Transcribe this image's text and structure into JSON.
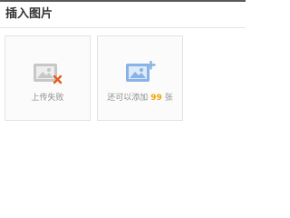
{
  "dialog": {
    "title": "插入图片"
  },
  "cards": {
    "failed": {
      "label": "上传失败",
      "icon": "image-failed-icon"
    },
    "add": {
      "label_prefix": "还可以添加",
      "count": "99",
      "label_suffix": "张",
      "icon": "image-add-icon"
    }
  },
  "colors": {
    "accent": "#f3a300",
    "error": "#e85a1e",
    "icon_blue": "#88b3e6",
    "icon_gray": "#c7c7c7"
  }
}
